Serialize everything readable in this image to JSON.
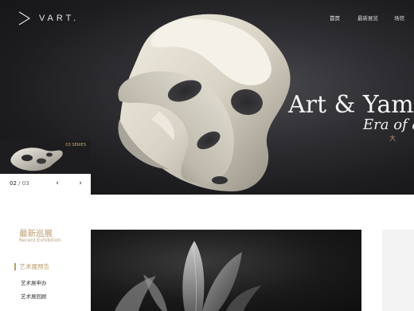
{
  "header": {
    "logo_text": "VART.",
    "nav": [
      {
        "label": "首页",
        "active": true
      },
      {
        "label": "最新展览",
        "active": false
      },
      {
        "label": "场馆",
        "active": false
      }
    ]
  },
  "hero": {
    "title": "Art & Yame",
    "subtitle": "Era of a",
    "chinese_caption": "大 型"
  },
  "slider": {
    "series_label": "03 SERIES",
    "current": "02",
    "separator": "/",
    "total": "03",
    "prev_icon": "chevron-left-icon",
    "next_icon": "chevron-right-icon"
  },
  "section": {
    "title": "最新巡展",
    "subtitle": "Recent Exhibition",
    "menu": [
      {
        "label": "艺术展预告",
        "active": true
      },
      {
        "label": "艺术展申办",
        "active": false
      },
      {
        "label": "艺术展回顾",
        "active": false
      }
    ]
  },
  "colors": {
    "accent_gold": "#b89a6a",
    "hero_dark": "#1c1c1f"
  }
}
